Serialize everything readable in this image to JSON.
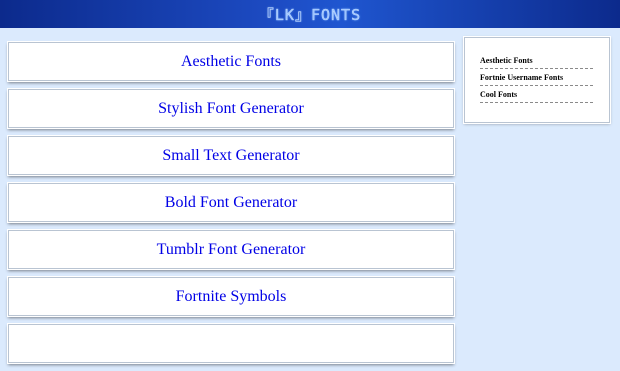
{
  "header": {
    "logo_text": "『LK』FONTS"
  },
  "main": {
    "items": [
      {
        "label": "Aesthetic Fonts"
      },
      {
        "label": "Stylish Font Generator"
      },
      {
        "label": "Small Text Generator"
      },
      {
        "label": "Bold Font Generator"
      },
      {
        "label": "Tumblr Font Generator"
      },
      {
        "label": "Fortnite Symbols"
      },
      {
        "label": ""
      }
    ]
  },
  "sidebar": {
    "links": [
      {
        "label": "Aesthetic Fonts"
      },
      {
        "label": "Fortnie Username Fonts"
      },
      {
        "label": "Cool Fonts"
      }
    ]
  },
  "colors": {
    "header_bg": "#1d4cc4",
    "page_bg": "#dbeafd",
    "link": "#0000e6"
  }
}
